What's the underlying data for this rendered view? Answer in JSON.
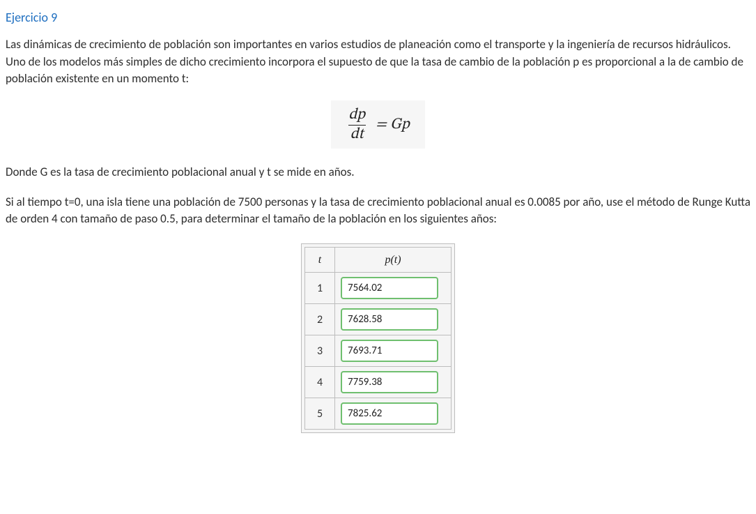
{
  "title": "Ejercicio 9",
  "para1": "Las dinámicas de crecimiento de población son importantes en varios estudios de planeación como el transporte y la ingeniería de recursos hidráulicos. Uno de los modelos más simples de dicho crecimiento incorpora el supuesto de que la tasa de cambio de la población p es proporcional a la de cambio de población existente en un momento t:",
  "equation": {
    "numerator": "dp",
    "denominator": "dt",
    "rhs": "= Gp"
  },
  "para2": "Donde G es la tasa de crecimiento poblacional anual y t se mide en años.",
  "para3": "Si al tiempo t=0, una isla tiene una población de 7500 personas y la tasa de crecimiento poblacional anual es 0.0085 por año, use el método de Runge Kutta de orden 4 con tamaño de paso 0.5, para determinar el tamaño de la población en los siguientes años:",
  "table": {
    "headers": {
      "t": "t",
      "pt": "p(t)"
    },
    "rows": [
      {
        "t": "1",
        "value": "7564.02"
      },
      {
        "t": "2",
        "value": "7628.58"
      },
      {
        "t": "3",
        "value": "7693.71"
      },
      {
        "t": "4",
        "value": "7759.38"
      },
      {
        "t": "5",
        "value": "7825.62"
      }
    ]
  }
}
